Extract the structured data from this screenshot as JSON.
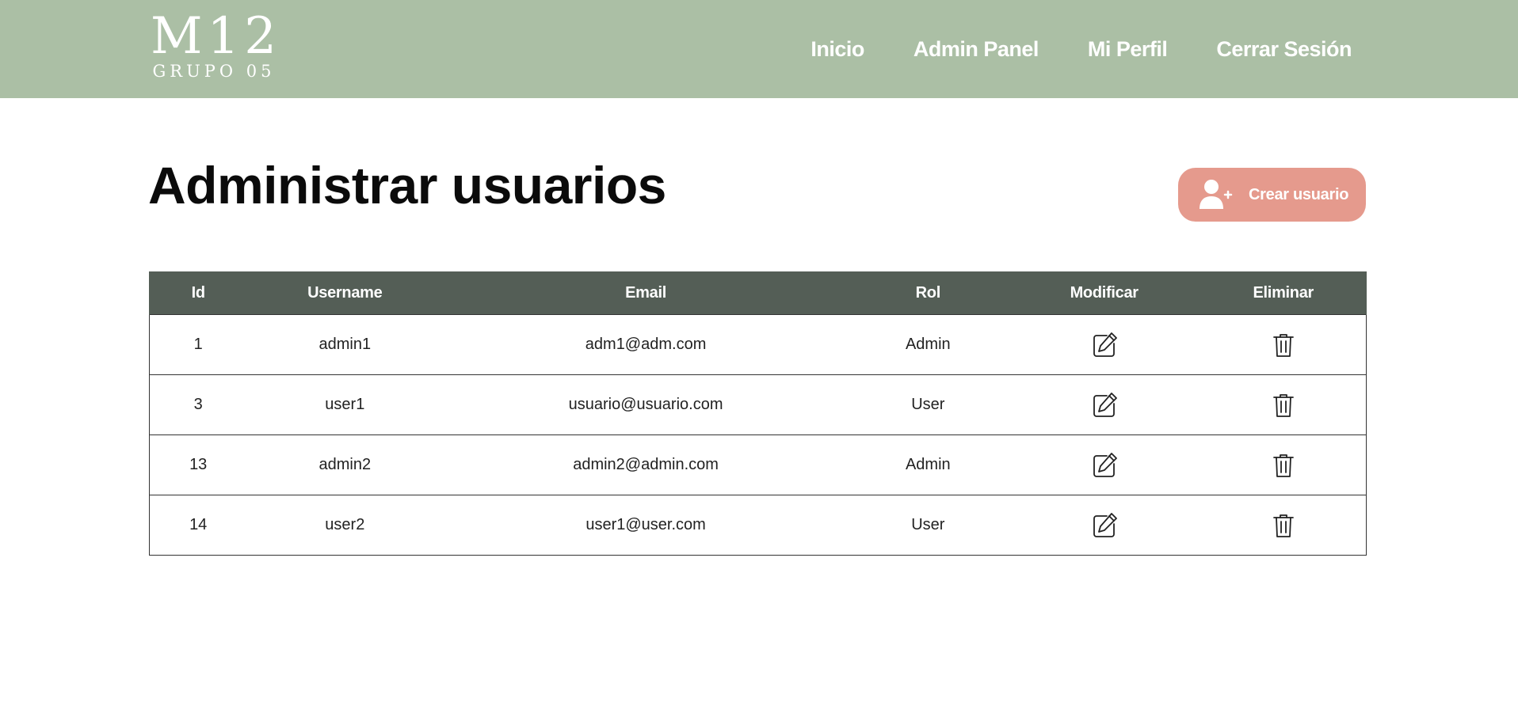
{
  "header": {
    "logo": {
      "main": "M12",
      "sub": "GRUPO 05"
    },
    "nav": [
      {
        "label": "Inicio"
      },
      {
        "label": "Admin Panel"
      },
      {
        "label": "Mi Perfil"
      },
      {
        "label": "Cerrar Sesión"
      }
    ],
    "background_color": "#abbfa5"
  },
  "main": {
    "title": "Administrar usuarios",
    "create_button": {
      "label": "Crear usuario",
      "icon": "add-user-icon",
      "color": "#e59a8d"
    },
    "table": {
      "header_color": "#545e56",
      "columns": [
        "Id",
        "Username",
        "Email",
        "Rol",
        "Modificar",
        "Eliminar"
      ],
      "rows": [
        {
          "id": "1",
          "username": "admin1",
          "email": "adm1@adm.com",
          "rol": "Admin",
          "modify_icon": "edit-icon",
          "delete_icon": "trash-icon"
        },
        {
          "id": "3",
          "username": "user1",
          "email": "usuario@usuario.com",
          "rol": "User",
          "modify_icon": "edit-icon",
          "delete_icon": "trash-icon"
        },
        {
          "id": "13",
          "username": "admin2",
          "email": "admin2@admin.com",
          "rol": "Admin",
          "modify_icon": "edit-icon",
          "delete_icon": "trash-icon"
        },
        {
          "id": "14",
          "username": "user2",
          "email": "user1@user.com",
          "rol": "User",
          "modify_icon": "edit-icon",
          "delete_icon": "trash-icon"
        }
      ]
    }
  }
}
